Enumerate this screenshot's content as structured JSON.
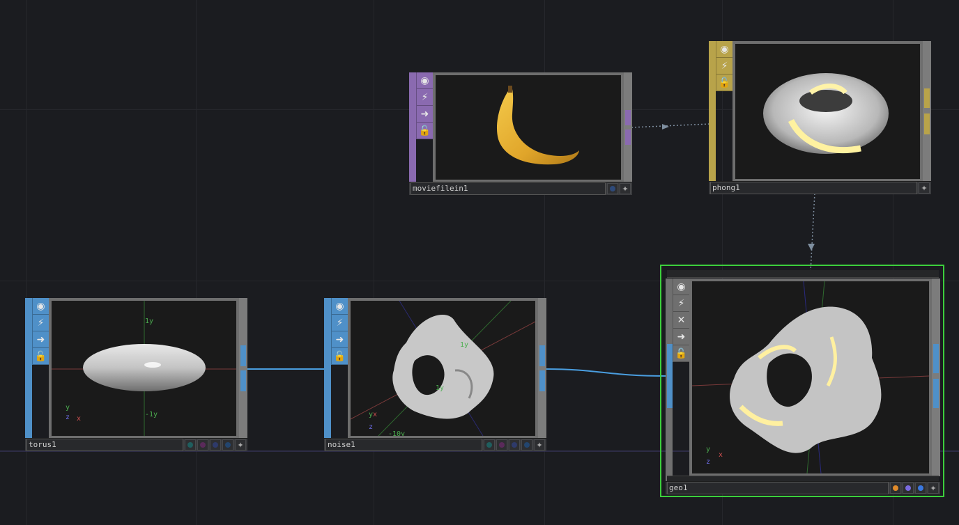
{
  "canvas": {
    "background": "#1b1c20"
  },
  "operator_colors": {
    "top": "#8a6ab0",
    "sop": "#4f90c8",
    "mat": "#b8a34a",
    "comp": "#3ccf3c"
  },
  "nodes": {
    "moviefilein1": {
      "name": "moviefilein1",
      "color": "#8a6ab0",
      "flags": [
        "dot-blue",
        "star"
      ]
    },
    "phong1": {
      "name": "phong1",
      "color": "#b8a34a",
      "flags": [
        "star"
      ]
    },
    "torus1": {
      "name": "torus1",
      "color": "#4f90c8",
      "flags": [
        "dot-teal",
        "dot-purple",
        "dot-blue",
        "dot-blue2",
        "star"
      ],
      "axis_labels": {
        "up": "1y",
        "down": "-1y",
        "gizmo_y": "y",
        "gizmo_z": "z",
        "gizmo_x": "x"
      }
    },
    "noise1": {
      "name": "noise1",
      "color": "#4f90c8",
      "flags": [
        "dot-teal",
        "dot-purple",
        "dot-blue",
        "dot-blue2",
        "star"
      ],
      "axis_labels": {
        "a": "1y",
        "b": "1y",
        "c": "-10y",
        "gizmo_y": "y",
        "gizmo_x": "x",
        "gizmo_z": "z"
      }
    },
    "geo1": {
      "name": "geo1",
      "color": "#4f90c8",
      "flags": [
        "dot-orange",
        "dot-violet",
        "dot-blue",
        "star"
      ],
      "axis_labels": {
        "gizmo_y": "y",
        "gizmo_x": "x",
        "gizmo_z": "z"
      }
    }
  },
  "icons": [
    "viewer-icon",
    "bypass-icon",
    "export-icon",
    "lock-icon",
    "cook-icon"
  ]
}
